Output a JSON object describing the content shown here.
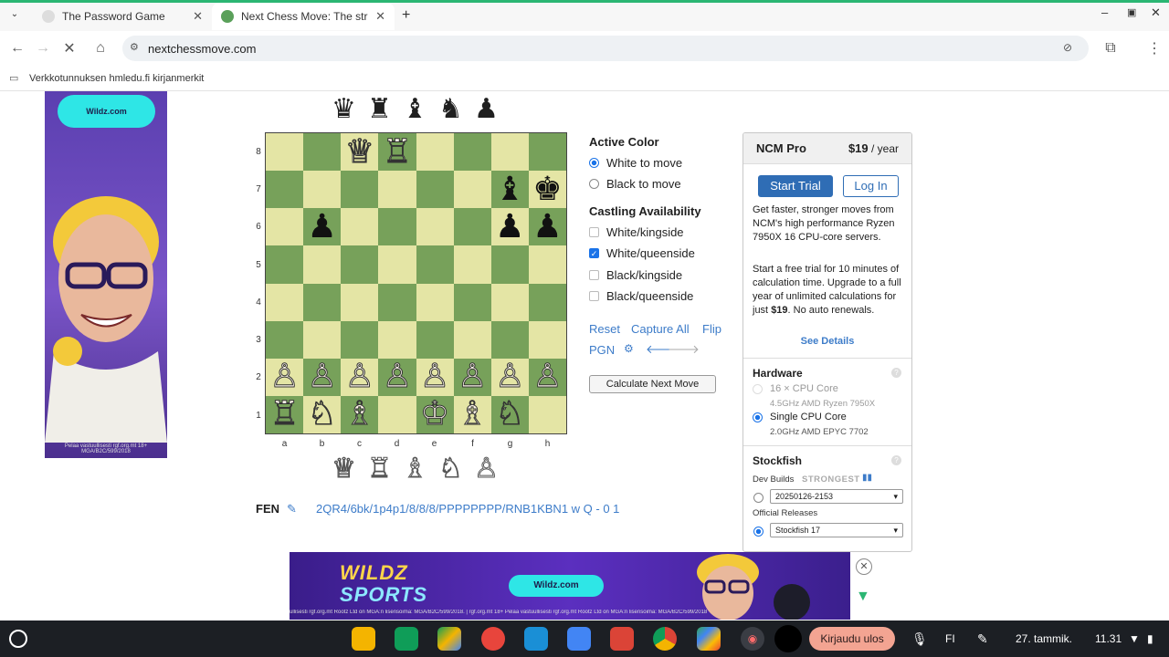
{
  "browser": {
    "tabs": [
      {
        "title": "The Password Game",
        "active": false
      },
      {
        "title": "Next Chess Move: The stronge",
        "active": true
      }
    ],
    "url": "nextchessmove.com",
    "bookmark": "Verkkotunnuksen hmledu.fi kirjanmerkit"
  },
  "ads": {
    "left_button": "Wildz.com",
    "left_footer": "Pelaa vastuullisesti rgf.org.mt 18+ MGA/B2C/599/2018",
    "bottom_brand": "WILDZ",
    "bottom_brand_2": "SPORTS",
    "bottom_button": "Wildz.com",
    "bottom_footer": "ullisesti rgf.org.mt Rootz Ltd on MGA:n lisensoima: MGA/B2C/599/2018. | rgf.org.mt 18+ Pelaa vastuullisesti rgf.org.mt Rootz Ltd on MGA:n lisensoima: MGA/B2C/599/2018"
  },
  "board": {
    "captured_top": [
      "♛",
      "♜",
      "♝",
      "♞",
      "♟"
    ],
    "captured_bottom": [
      "♕",
      "♖",
      "♗",
      "♘",
      "♙"
    ],
    "ranks": [
      "8",
      "7",
      "6",
      "5",
      "4",
      "3",
      "2",
      "1"
    ],
    "files": [
      "a",
      "b",
      "c",
      "d",
      "e",
      "f",
      "g",
      "h"
    ],
    "position": [
      [
        "",
        "",
        "wQ",
        "wR",
        "",
        "",
        "",
        ""
      ],
      [
        "",
        "",
        "",
        "",
        "",
        "",
        "bB",
        "bK"
      ],
      [
        "",
        "bP",
        "",
        "",
        "",
        "",
        "bP",
        "bP"
      ],
      [
        "",
        "",
        "",
        "",
        "",
        "",
        "",
        ""
      ],
      [
        "",
        "",
        "",
        "",
        "",
        "",
        "",
        ""
      ],
      [
        "",
        "",
        "",
        "",
        "",
        "",
        "",
        ""
      ],
      [
        "wP",
        "wP",
        "wP",
        "wP",
        "wP",
        "wP",
        "wP",
        "wP"
      ],
      [
        "wR",
        "wN",
        "wB",
        "",
        "wK",
        "wB",
        "wN",
        ""
      ]
    ]
  },
  "options": {
    "active_color_title": "Active Color",
    "white_to_move": "White to move",
    "black_to_move": "Black to move",
    "castling_title": "Castling Availability",
    "castling": [
      {
        "label": "White/kingside",
        "checked": false
      },
      {
        "label": "White/queenside",
        "checked": true
      },
      {
        "label": "Black/kingside",
        "checked": false
      },
      {
        "label": "Black/queenside",
        "checked": false
      }
    ],
    "reset": "Reset",
    "capture_all": "Capture All",
    "flip": "Flip",
    "pgn": "PGN",
    "calculate": "Calculate Next Move"
  },
  "fen": {
    "label": "FEN",
    "value": "2QR4/6bk/1p4p1/8/8/8/PPPPPPPP/RNB1KBN1 w Q - 0 1"
  },
  "pro": {
    "title": "NCM Pro",
    "price": "$19",
    "per": " / year",
    "start_trial": "Start Trial",
    "log_in": "Log In",
    "desc1": "Get faster, stronger moves from NCM's high performance Ryzen 7950X 16 CPU-core servers.",
    "desc2a": "Start a free trial for 10 minutes of calculation time. Upgrade to a full year of unlimited calculations for just ",
    "desc2b": "$19",
    "desc2c": ". No auto renewals.",
    "see_details": "See Details",
    "hardware_title": "Hardware",
    "hw1": "16 × CPU Core",
    "hw1_sub": "4.5GHz AMD Ryzen 7950X",
    "hw2": "Single CPU Core",
    "hw2_sub": "2.0GHz AMD EPYC 7702",
    "stockfish_title": "Stockfish",
    "dev_builds": "Dev Builds",
    "strongest": "STRONGEST",
    "dev_select": "20250126-2153",
    "official": "Official Releases",
    "official_select": "Stockfish 17"
  },
  "shelf": {
    "signout": "Kirjaudu ulos",
    "lang": "FI",
    "date": "27. tammik.",
    "time": "11.31"
  }
}
